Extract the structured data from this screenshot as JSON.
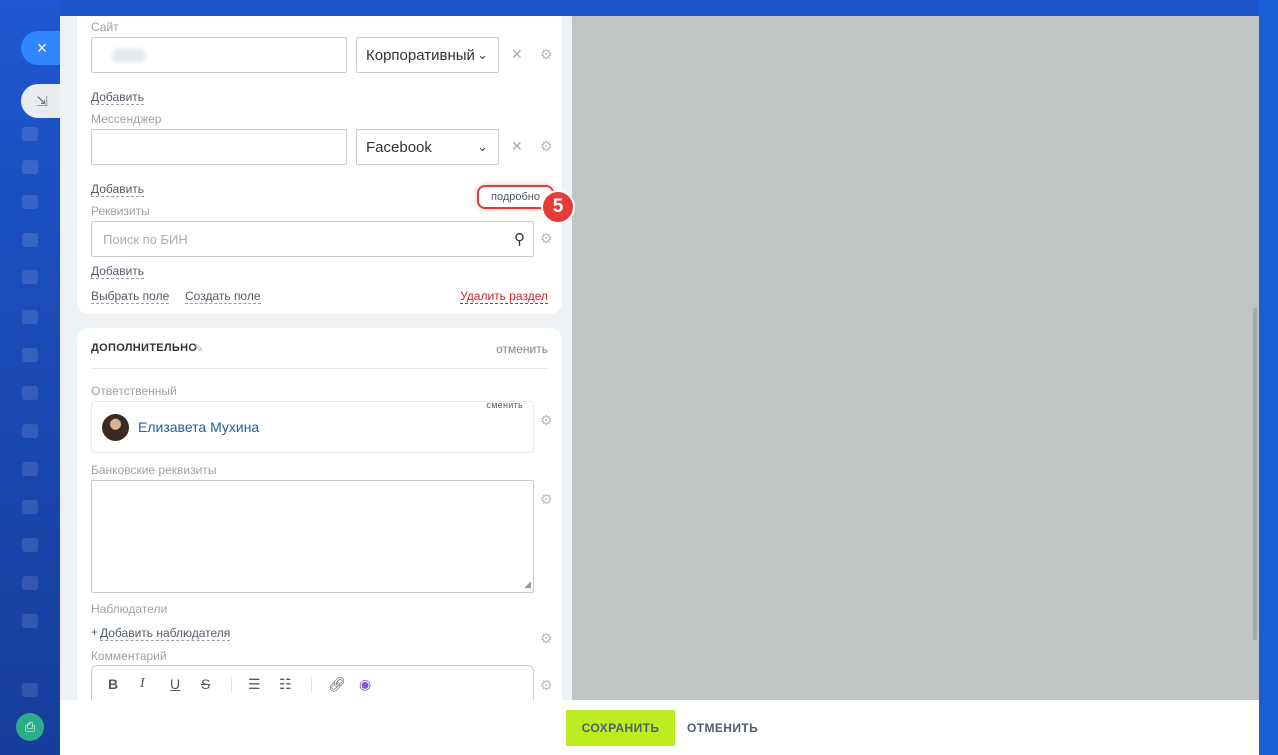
{
  "sidebar": {
    "close_icon": "×",
    "minimize_icon": "⇲",
    "print_icon": "⎙"
  },
  "contacts": {
    "site": {
      "label": "Сайт",
      "type_value": "Корпоративный",
      "add_label": "Добавить"
    },
    "messenger": {
      "label": "Мессенджер",
      "type_value": "Facebook",
      "add_label": "Добавить"
    },
    "requisites": {
      "label": "Реквизиты",
      "details_link": "подробно",
      "marker_number": "5",
      "search_placeholder": "Поиск по БИН",
      "add_label": "Добавить"
    },
    "actions": {
      "choose_field": "Выбрать поле",
      "create_field": "Создать поле",
      "delete_section": "Удалить раздел"
    }
  },
  "additional": {
    "title": "ДОПОЛНИТЕЛЬНО",
    "cancel_link": "отменить",
    "responsible": {
      "label": "Ответственный",
      "change_link": "сменить",
      "name": "Елизавета Мухина"
    },
    "bank_details": {
      "label": "Банковские реквизиты"
    },
    "observers": {
      "label": "Наблюдатели",
      "add_link": "Добавить наблюдателя"
    },
    "comment": {
      "label": "Комментарий",
      "toolbar": {
        "bold": "B",
        "italic": "I",
        "underline": "U",
        "strike": "S"
      }
    }
  },
  "footer": {
    "save_label": "СОХРАНИТЬ",
    "cancel_label": "ОТМЕНИТЬ"
  },
  "colors": {
    "save_button": "#bbed21",
    "marker": "#e53b3b",
    "delete_link": "#d0272b",
    "responsible_name": "#1f5fa8"
  }
}
